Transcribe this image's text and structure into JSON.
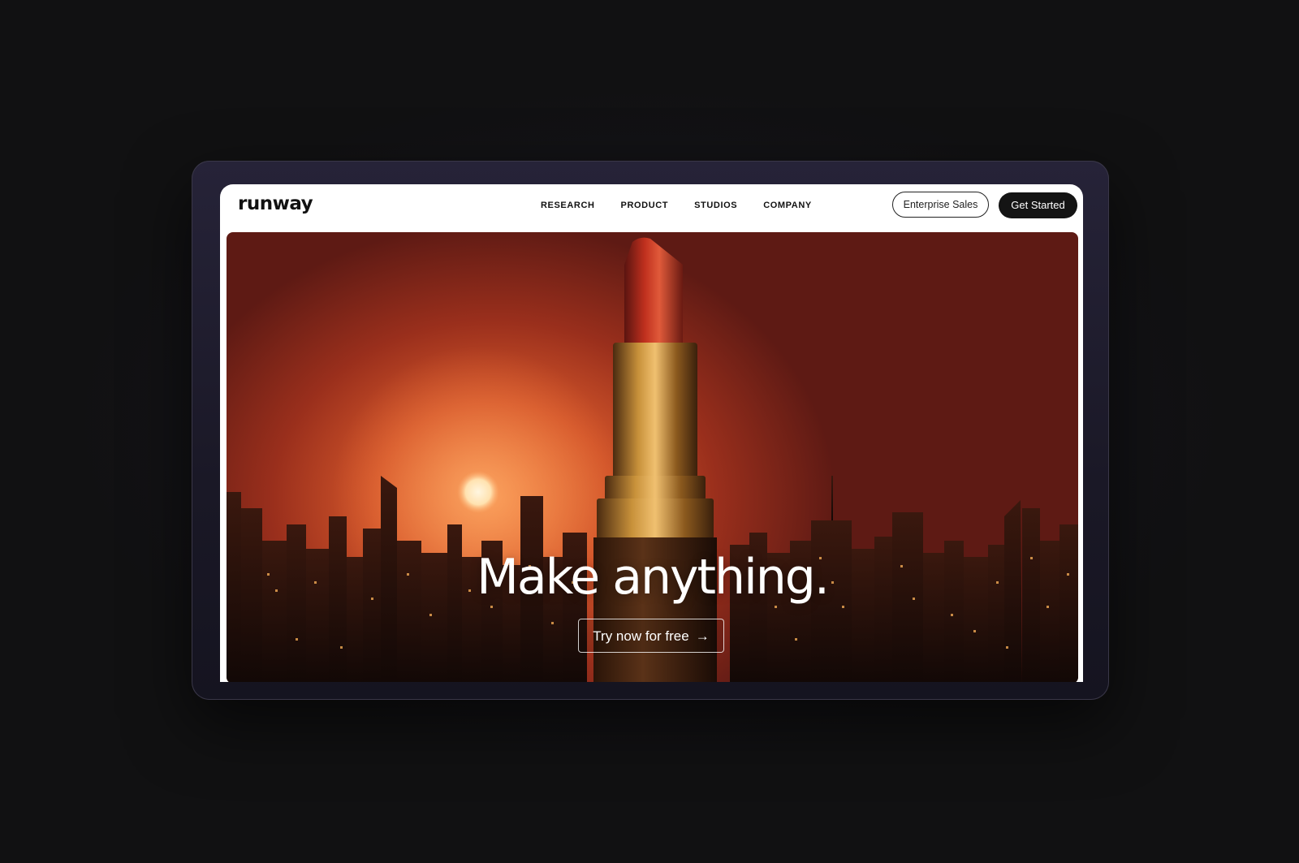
{
  "brand": {
    "logo_text": "runway"
  },
  "nav": {
    "links": [
      {
        "label": "RESEARCH"
      },
      {
        "label": "PRODUCT"
      },
      {
        "label": "STUDIOS"
      },
      {
        "label": "COMPANY"
      }
    ],
    "enterprise_label": "Enterprise Sales",
    "get_started_label": "Get Started"
  },
  "hero": {
    "headline": "Make anything.",
    "cta_label": "Try now for free",
    "cta_icon": "arrow-right-icon"
  },
  "colors": {
    "page_background": "#111112",
    "device_frame": "#1f1d2e",
    "nav_background": "#ffffff",
    "primary_button": "#141414",
    "hero_sky": "#d1552a",
    "lipstick_red": "#b5271b",
    "lipstick_gold": "#b07a2a"
  }
}
